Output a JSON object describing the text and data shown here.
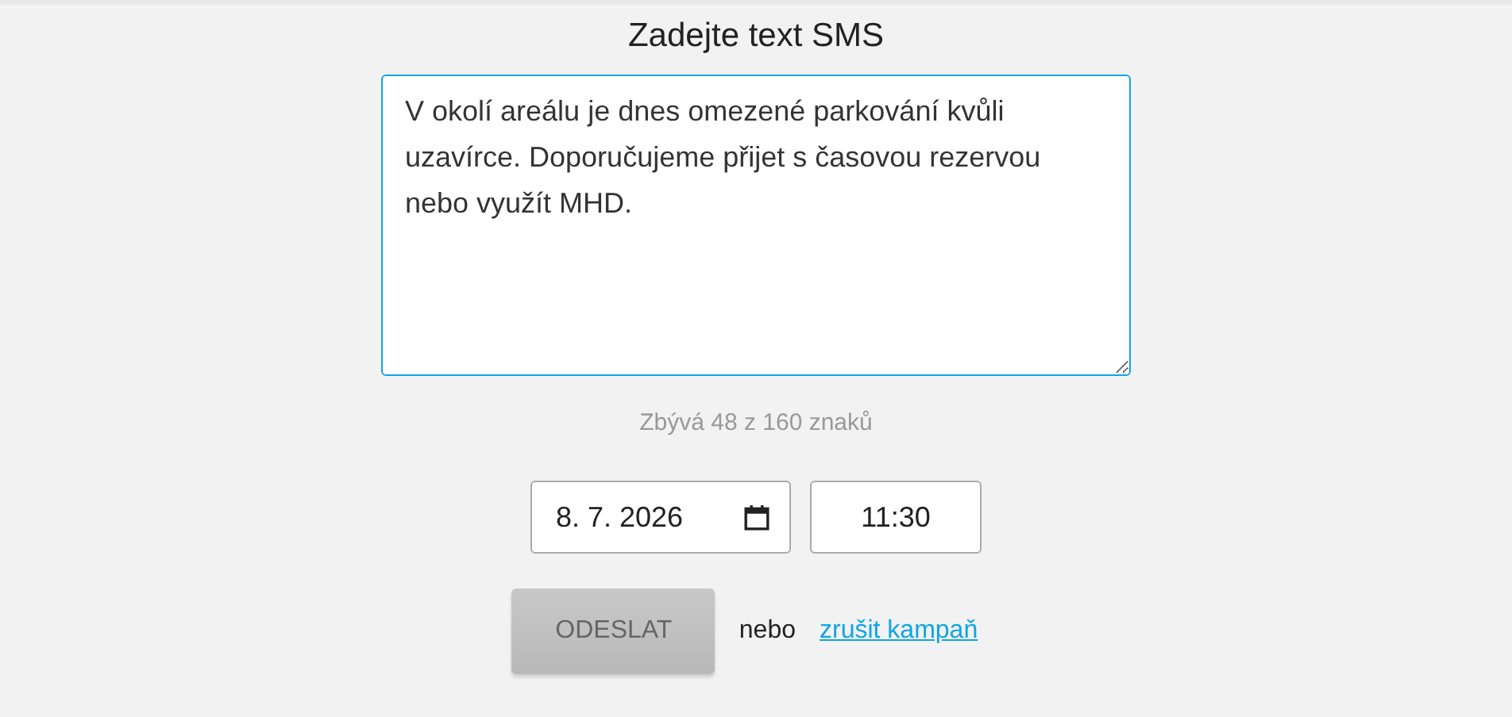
{
  "heading": "Zadejte text SMS",
  "message": {
    "value": "V okolí areálu je dnes omezené parkování kvůli uzavírce. Doporučujeme přijet s časovou rezervou nebo využít MHD.",
    "focused": true
  },
  "counter": "Zbývá 48 z 160 znaků",
  "date": {
    "value": "8. 7. 2026"
  },
  "time": {
    "value": "11:30"
  },
  "send_button": {
    "label": "ODESLAT",
    "disabled": true
  },
  "or_text": "nebo",
  "cancel_link": "zrušit kampaň"
}
